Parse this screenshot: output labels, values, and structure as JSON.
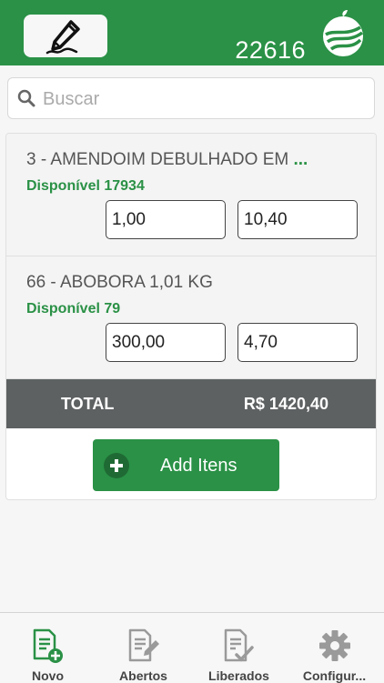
{
  "header": {
    "order_number": "22616",
    "edit_icon": "pen-signature-icon",
    "logo_icon": "apple-field-logo"
  },
  "search": {
    "placeholder": "Buscar",
    "value": "",
    "icon": "search-icon"
  },
  "items": [
    {
      "name": "3 - AMENDOIM DEBULHADO EM",
      "more": "...",
      "available": "Disponível 17934",
      "quantity": "1,00",
      "price": "10,40"
    },
    {
      "name": "66 - ABOBORA 1,01 KG",
      "more": "",
      "available": "Disponível 79",
      "quantity": "300,00",
      "price": "4,70"
    }
  ],
  "total": {
    "label": "TOTAL",
    "value": "R$ 1420,40"
  },
  "add_button": {
    "label": "Add Itens",
    "icon": "plus-circle-icon"
  },
  "tabs": [
    {
      "label": "Novo",
      "icon": "new-document-icon",
      "active": true
    },
    {
      "label": "Abertos",
      "icon": "edit-document-icon",
      "active": false
    },
    {
      "label": "Liberados",
      "icon": "checked-document-icon",
      "active": false
    },
    {
      "label": "Configur...",
      "icon": "gear-icon",
      "active": false
    }
  ],
  "colors": {
    "brand_green": "#2a9146",
    "total_bar": "#5e6162",
    "inactive_icon": "#9a9a9a"
  }
}
